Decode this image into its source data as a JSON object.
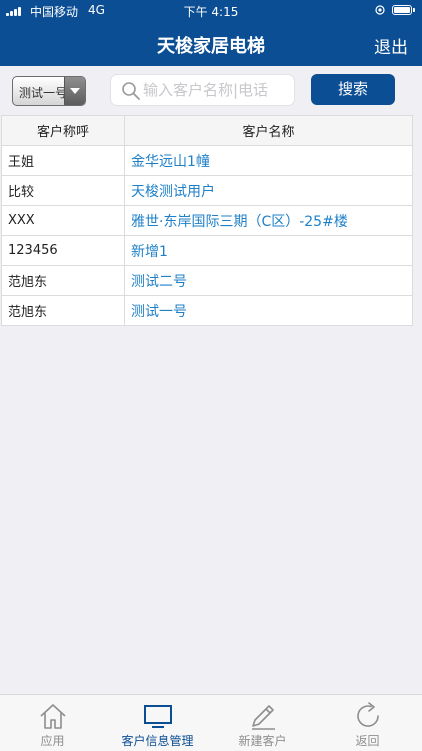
{
  "status": {
    "carrier": "中国移动",
    "network": "4G",
    "time": "下午 4:15"
  },
  "header": {
    "title": "天梭家居电梯",
    "logout": "退出"
  },
  "search": {
    "select_value": "测试一号",
    "placeholder": "输入客户名称|电话",
    "button": "搜索"
  },
  "table": {
    "headers": [
      "客户称呼",
      "客户名称"
    ],
    "rows": [
      {
        "call": "王姐",
        "name": "金华远山1幢"
      },
      {
        "call": "比较",
        "name": "天梭测试用户"
      },
      {
        "call": "XXX",
        "name": "雅世·东岸国际三期（C区）-25#楼"
      },
      {
        "call": "123456",
        "name": "新增1"
      },
      {
        "call": "范旭东",
        "name": "测试二号"
      },
      {
        "call": "范旭东",
        "name": "测试一号"
      }
    ]
  },
  "tabs": [
    {
      "label": "应用",
      "icon": "home-icon"
    },
    {
      "label": "客户信息管理",
      "icon": "monitor-icon",
      "active": true
    },
    {
      "label": "新建客户",
      "icon": "pencil-icon"
    },
    {
      "label": "返回",
      "icon": "refresh-icon"
    }
  ],
  "colors": {
    "primary": "#0c4e94",
    "link": "#1f80c8",
    "background": "#efeff4"
  }
}
